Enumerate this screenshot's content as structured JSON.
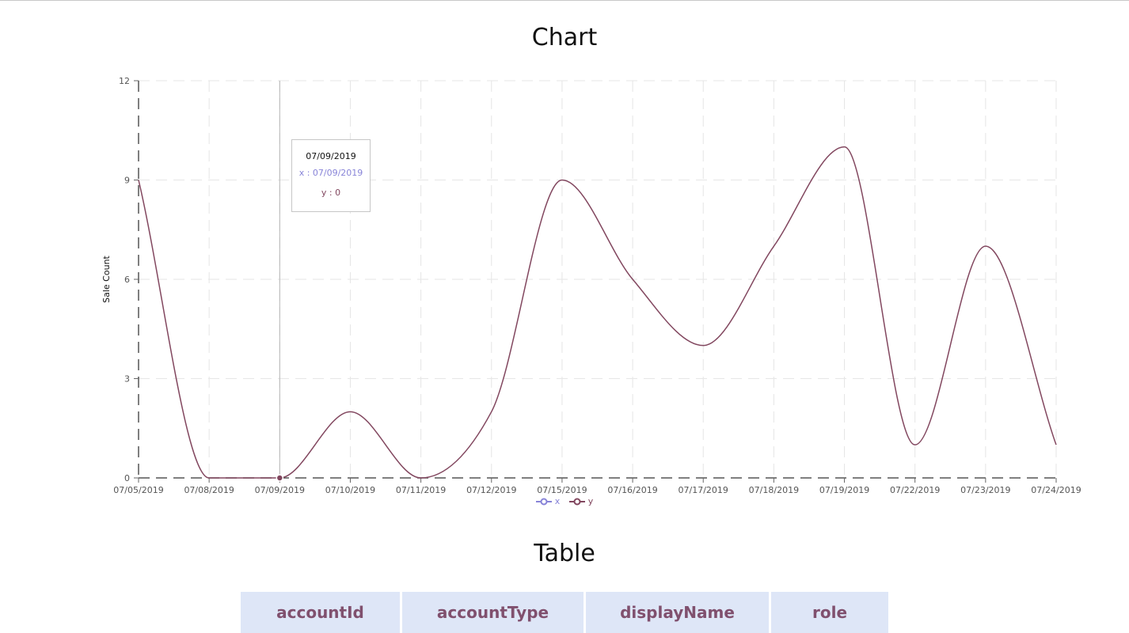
{
  "chart_section_title": "Chart",
  "table_section_title": "Table",
  "chart_data": {
    "type": "line",
    "title": "",
    "xlabel": "",
    "ylabel": "Sale Count",
    "categories": [
      "07/05/2019",
      "07/08/2019",
      "07/09/2019",
      "07/10/2019",
      "07/11/2019",
      "07/12/2019",
      "07/15/2019",
      "07/16/2019",
      "07/17/2019",
      "07/18/2019",
      "07/19/2019",
      "07/22/2019",
      "07/23/2019",
      "07/24/2019"
    ],
    "series": [
      {
        "name": "y",
        "values": [
          9,
          0,
          0,
          2,
          0,
          2,
          9,
          6,
          4,
          7,
          10,
          1,
          7,
          1
        ],
        "color": "#82475f"
      }
    ],
    "ylim": [
      0,
      12
    ],
    "yticks": [
      0,
      3,
      6,
      9,
      12
    ],
    "grid": true,
    "grid_style": "dashed",
    "legend": {
      "placement": "bottom-center",
      "entries": [
        {
          "label": "x",
          "color": "#8884d8"
        },
        {
          "label": "y",
          "color": "#82475f"
        }
      ]
    },
    "tooltip": {
      "label": "07/09/2019",
      "x_text": "x : 07/09/2019",
      "y_text": "y : 0",
      "active_category": "07/09/2019"
    }
  },
  "table": {
    "columns": [
      "accountId",
      "accountType",
      "displayName",
      "role"
    ],
    "header_background": "#dee6f7",
    "header_text_color": "#80506e"
  }
}
